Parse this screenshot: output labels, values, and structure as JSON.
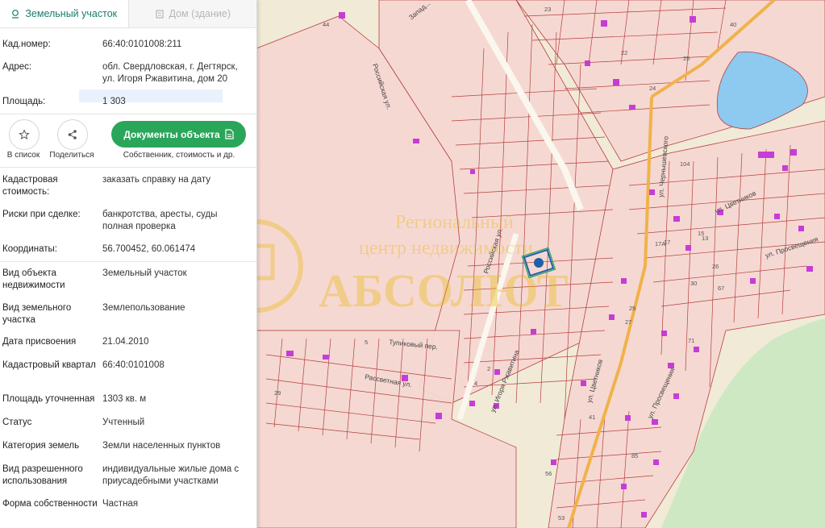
{
  "tabs": {
    "land": "Земельный участок",
    "building": "Дом (здание)"
  },
  "header_info": {
    "cad_label": "Кад.номер:",
    "cad_value": "66:40:0101008:211",
    "address_label": "Адрес:",
    "address_line1": "обл. Свердловская, г. Дегтярск,",
    "address_line2": "ул. Игоря Ржавитина, дом 20",
    "area_label": "Площадь:",
    "area_value": "1 303"
  },
  "actions": {
    "favorite": "В список",
    "share": "Поделиться",
    "documents": "Документы объекта",
    "documents_sub": "Собственник, стоимость и др."
  },
  "details": [
    {
      "key": "Кадастровая стоимость:",
      "value": "заказать справку на дату",
      "link": true
    },
    {
      "key": "Риски при сделке:",
      "value": "банкротства, аресты, суды",
      "value2": "полная проверка"
    },
    {
      "key": "Координаты:",
      "value": "56.700452, 60.061474"
    },
    {
      "key": "Вид объекта недвижимости",
      "value": "Земельный участок"
    },
    {
      "key": "Вид земельного участка",
      "value": "Землепользование"
    },
    {
      "key": "Дата присвоения",
      "value": "21.04.2010"
    },
    {
      "key": "Кадастровый квартал",
      "value": "66:40:0101008"
    },
    {
      "key": "Площадь уточненная",
      "value": "1303 кв. м"
    },
    {
      "key": "Статус",
      "value": "Учтенный"
    },
    {
      "key": "Категория земель",
      "value": "Земли населенных пунктов"
    },
    {
      "key": "Вид разрешенного использования",
      "value": "индивидуальные жилые дома с приусадебными участками"
    },
    {
      "key": "Форма собственности",
      "value": "Частная"
    }
  ],
  "map_labels": {
    "streets": [
      "Российская ул.",
      "ул. Игоря Ржавитина",
      "ул. Цветников",
      "ул. Чернышевского",
      "ул. Просвещения",
      "Тупиковый пер.",
      "Рассветная ул.",
      "Запад..."
    ],
    "house_numbers": [
      "23",
      "40",
      "44",
      "24",
      "22",
      "25",
      "17",
      "15",
      "104",
      "13",
      "26",
      "30",
      "67",
      "29",
      "27",
      "71",
      "17А",
      "5",
      "29",
      "41",
      "85",
      "56",
      "53",
      "2",
      "4"
    ],
    "watermark_lines": [
      "Региональный",
      "центр недвижимости",
      "АБСОЛЮТ"
    ]
  },
  "colors": {
    "accent": "#1a7d6b",
    "button": "#2aa65a",
    "link": "#1a6fb0",
    "parcel_fill": "#f6d8d2",
    "parcel_line": "#b44040",
    "marker": "#1f5fa8",
    "water": "#8ec9ef",
    "forest": "#cfe8c4"
  }
}
